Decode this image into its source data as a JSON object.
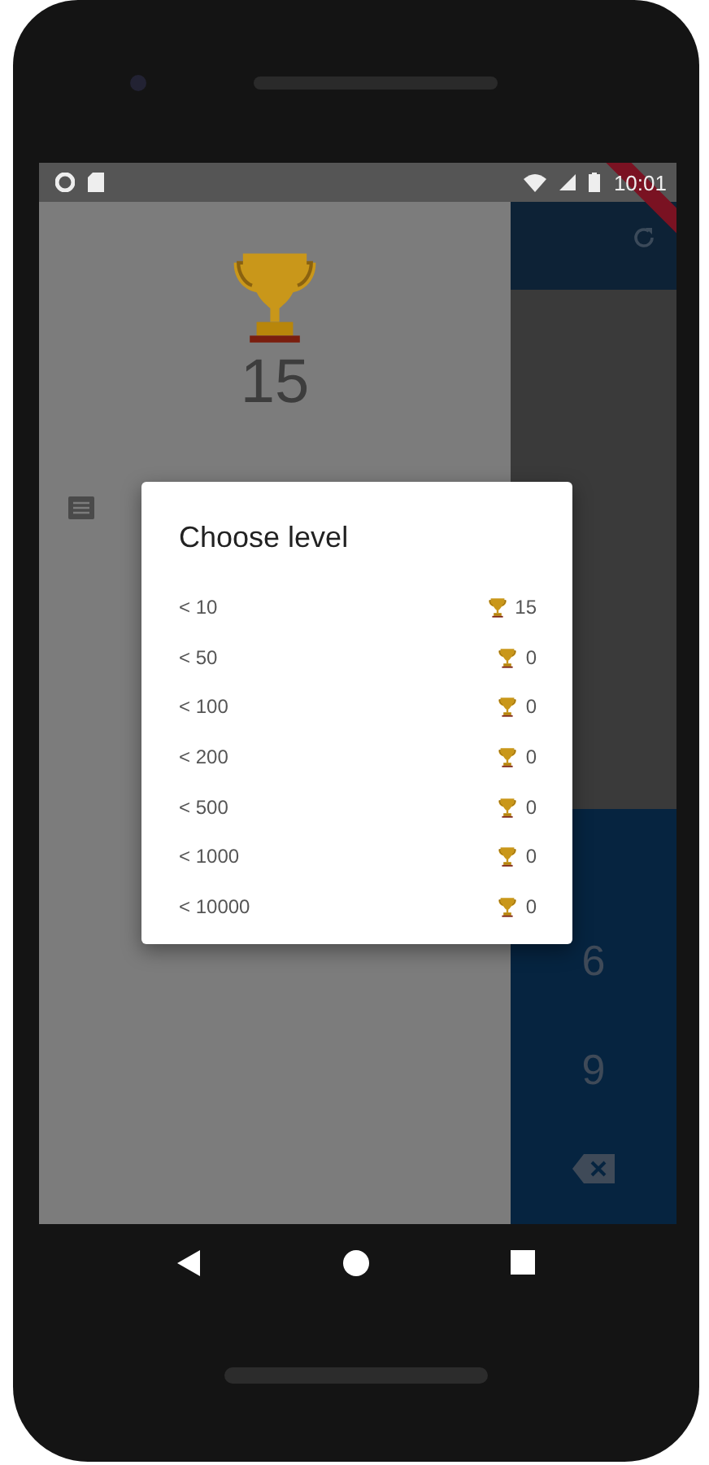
{
  "status_bar": {
    "time": "10:01"
  },
  "drawer": {
    "score": "15"
  },
  "keypad": {
    "keys": [
      "6",
      "9"
    ]
  },
  "dialog": {
    "title": "Choose level",
    "levels": [
      {
        "label": "< 10",
        "count": "15"
      },
      {
        "label": "< 50",
        "count": "0"
      },
      {
        "label": "< 100",
        "count": "0"
      },
      {
        "label": "< 200",
        "count": "0"
      },
      {
        "label": "< 500",
        "count": "0"
      },
      {
        "label": "< 1000",
        "count": "0"
      },
      {
        "label": "< 10000",
        "count": "0"
      }
    ]
  }
}
